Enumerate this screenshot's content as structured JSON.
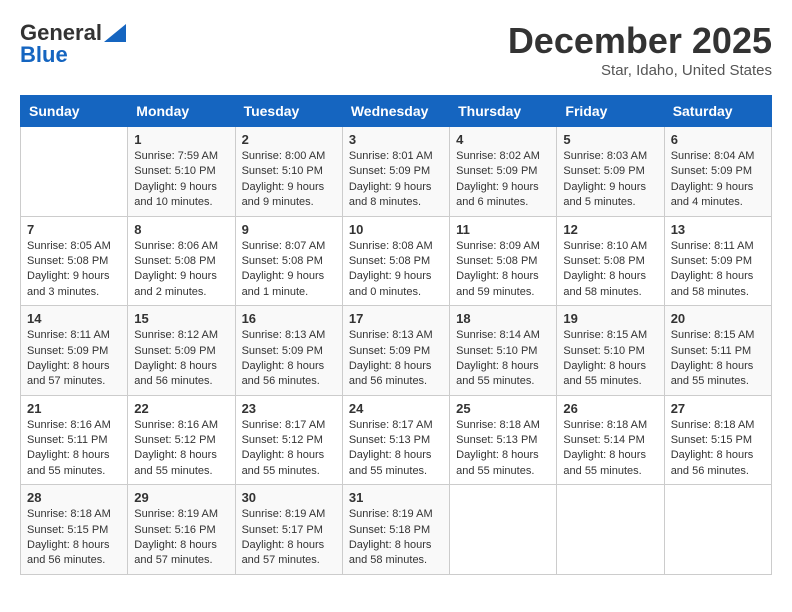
{
  "header": {
    "logo_general": "General",
    "logo_blue": "Blue",
    "month_title": "December 2025",
    "location": "Star, Idaho, United States"
  },
  "days_of_week": [
    "Sunday",
    "Monday",
    "Tuesday",
    "Wednesday",
    "Thursday",
    "Friday",
    "Saturday"
  ],
  "weeks": [
    [
      {
        "num": "",
        "info": ""
      },
      {
        "num": "1",
        "info": "Sunrise: 7:59 AM\nSunset: 5:10 PM\nDaylight: 9 hours\nand 10 minutes."
      },
      {
        "num": "2",
        "info": "Sunrise: 8:00 AM\nSunset: 5:10 PM\nDaylight: 9 hours\nand 9 minutes."
      },
      {
        "num": "3",
        "info": "Sunrise: 8:01 AM\nSunset: 5:09 PM\nDaylight: 9 hours\nand 8 minutes."
      },
      {
        "num": "4",
        "info": "Sunrise: 8:02 AM\nSunset: 5:09 PM\nDaylight: 9 hours\nand 6 minutes."
      },
      {
        "num": "5",
        "info": "Sunrise: 8:03 AM\nSunset: 5:09 PM\nDaylight: 9 hours\nand 5 minutes."
      },
      {
        "num": "6",
        "info": "Sunrise: 8:04 AM\nSunset: 5:09 PM\nDaylight: 9 hours\nand 4 minutes."
      }
    ],
    [
      {
        "num": "7",
        "info": "Sunrise: 8:05 AM\nSunset: 5:08 PM\nDaylight: 9 hours\nand 3 minutes."
      },
      {
        "num": "8",
        "info": "Sunrise: 8:06 AM\nSunset: 5:08 PM\nDaylight: 9 hours\nand 2 minutes."
      },
      {
        "num": "9",
        "info": "Sunrise: 8:07 AM\nSunset: 5:08 PM\nDaylight: 9 hours\nand 1 minute."
      },
      {
        "num": "10",
        "info": "Sunrise: 8:08 AM\nSunset: 5:08 PM\nDaylight: 9 hours\nand 0 minutes."
      },
      {
        "num": "11",
        "info": "Sunrise: 8:09 AM\nSunset: 5:08 PM\nDaylight: 8 hours\nand 59 minutes."
      },
      {
        "num": "12",
        "info": "Sunrise: 8:10 AM\nSunset: 5:08 PM\nDaylight: 8 hours\nand 58 minutes."
      },
      {
        "num": "13",
        "info": "Sunrise: 8:11 AM\nSunset: 5:09 PM\nDaylight: 8 hours\nand 58 minutes."
      }
    ],
    [
      {
        "num": "14",
        "info": "Sunrise: 8:11 AM\nSunset: 5:09 PM\nDaylight: 8 hours\nand 57 minutes."
      },
      {
        "num": "15",
        "info": "Sunrise: 8:12 AM\nSunset: 5:09 PM\nDaylight: 8 hours\nand 56 minutes."
      },
      {
        "num": "16",
        "info": "Sunrise: 8:13 AM\nSunset: 5:09 PM\nDaylight: 8 hours\nand 56 minutes."
      },
      {
        "num": "17",
        "info": "Sunrise: 8:13 AM\nSunset: 5:09 PM\nDaylight: 8 hours\nand 56 minutes."
      },
      {
        "num": "18",
        "info": "Sunrise: 8:14 AM\nSunset: 5:10 PM\nDaylight: 8 hours\nand 55 minutes."
      },
      {
        "num": "19",
        "info": "Sunrise: 8:15 AM\nSunset: 5:10 PM\nDaylight: 8 hours\nand 55 minutes."
      },
      {
        "num": "20",
        "info": "Sunrise: 8:15 AM\nSunset: 5:11 PM\nDaylight: 8 hours\nand 55 minutes."
      }
    ],
    [
      {
        "num": "21",
        "info": "Sunrise: 8:16 AM\nSunset: 5:11 PM\nDaylight: 8 hours\nand 55 minutes."
      },
      {
        "num": "22",
        "info": "Sunrise: 8:16 AM\nSunset: 5:12 PM\nDaylight: 8 hours\nand 55 minutes."
      },
      {
        "num": "23",
        "info": "Sunrise: 8:17 AM\nSunset: 5:12 PM\nDaylight: 8 hours\nand 55 minutes."
      },
      {
        "num": "24",
        "info": "Sunrise: 8:17 AM\nSunset: 5:13 PM\nDaylight: 8 hours\nand 55 minutes."
      },
      {
        "num": "25",
        "info": "Sunrise: 8:18 AM\nSunset: 5:13 PM\nDaylight: 8 hours\nand 55 minutes."
      },
      {
        "num": "26",
        "info": "Sunrise: 8:18 AM\nSunset: 5:14 PM\nDaylight: 8 hours\nand 55 minutes."
      },
      {
        "num": "27",
        "info": "Sunrise: 8:18 AM\nSunset: 5:15 PM\nDaylight: 8 hours\nand 56 minutes."
      }
    ],
    [
      {
        "num": "28",
        "info": "Sunrise: 8:18 AM\nSunset: 5:15 PM\nDaylight: 8 hours\nand 56 minutes."
      },
      {
        "num": "29",
        "info": "Sunrise: 8:19 AM\nSunset: 5:16 PM\nDaylight: 8 hours\nand 57 minutes."
      },
      {
        "num": "30",
        "info": "Sunrise: 8:19 AM\nSunset: 5:17 PM\nDaylight: 8 hours\nand 57 minutes."
      },
      {
        "num": "31",
        "info": "Sunrise: 8:19 AM\nSunset: 5:18 PM\nDaylight: 8 hours\nand 58 minutes."
      },
      {
        "num": "",
        "info": ""
      },
      {
        "num": "",
        "info": ""
      },
      {
        "num": "",
        "info": ""
      }
    ]
  ]
}
